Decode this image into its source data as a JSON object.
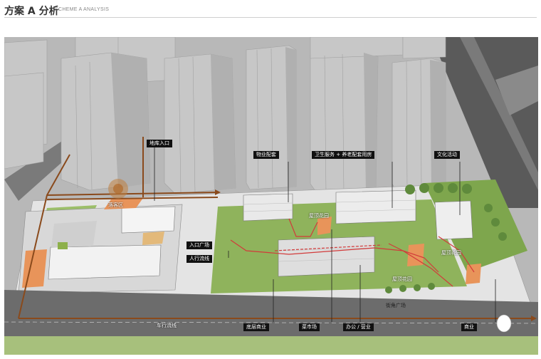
{
  "header": {
    "title": "方案 A 分析",
    "subtitle": "SCHEME A ANALYSIS"
  },
  "labels": {
    "garage_entrance": "地库入口",
    "property_support": "物业配套",
    "health_elderly": "卫生服务 + 养老配套用房",
    "cultural_activity": "文化活动",
    "rooftop_garden_1": "屋顶花园",
    "rooftop_garden_2": "屋顶花园",
    "rooftop_garden_3": "屋顶花园",
    "waiting_area": "落客区",
    "entrance_plaza": "入口广场",
    "pedestrian_flow": "人行流线",
    "street_corner_plaza": "街角广场",
    "vehicle_flow": "车行流线",
    "ground_commerce": "底层商业",
    "vegetable_market": "菜市场",
    "office_business": "办公 / 营业",
    "commerce": "商业"
  },
  "colors": {
    "vehicle_flow": "#8a4a1c",
    "pedestrian_flow": "#d23a3a",
    "grass": "#8fb35c",
    "road": "#6c6c6c",
    "tower": "#c9c9c9"
  }
}
